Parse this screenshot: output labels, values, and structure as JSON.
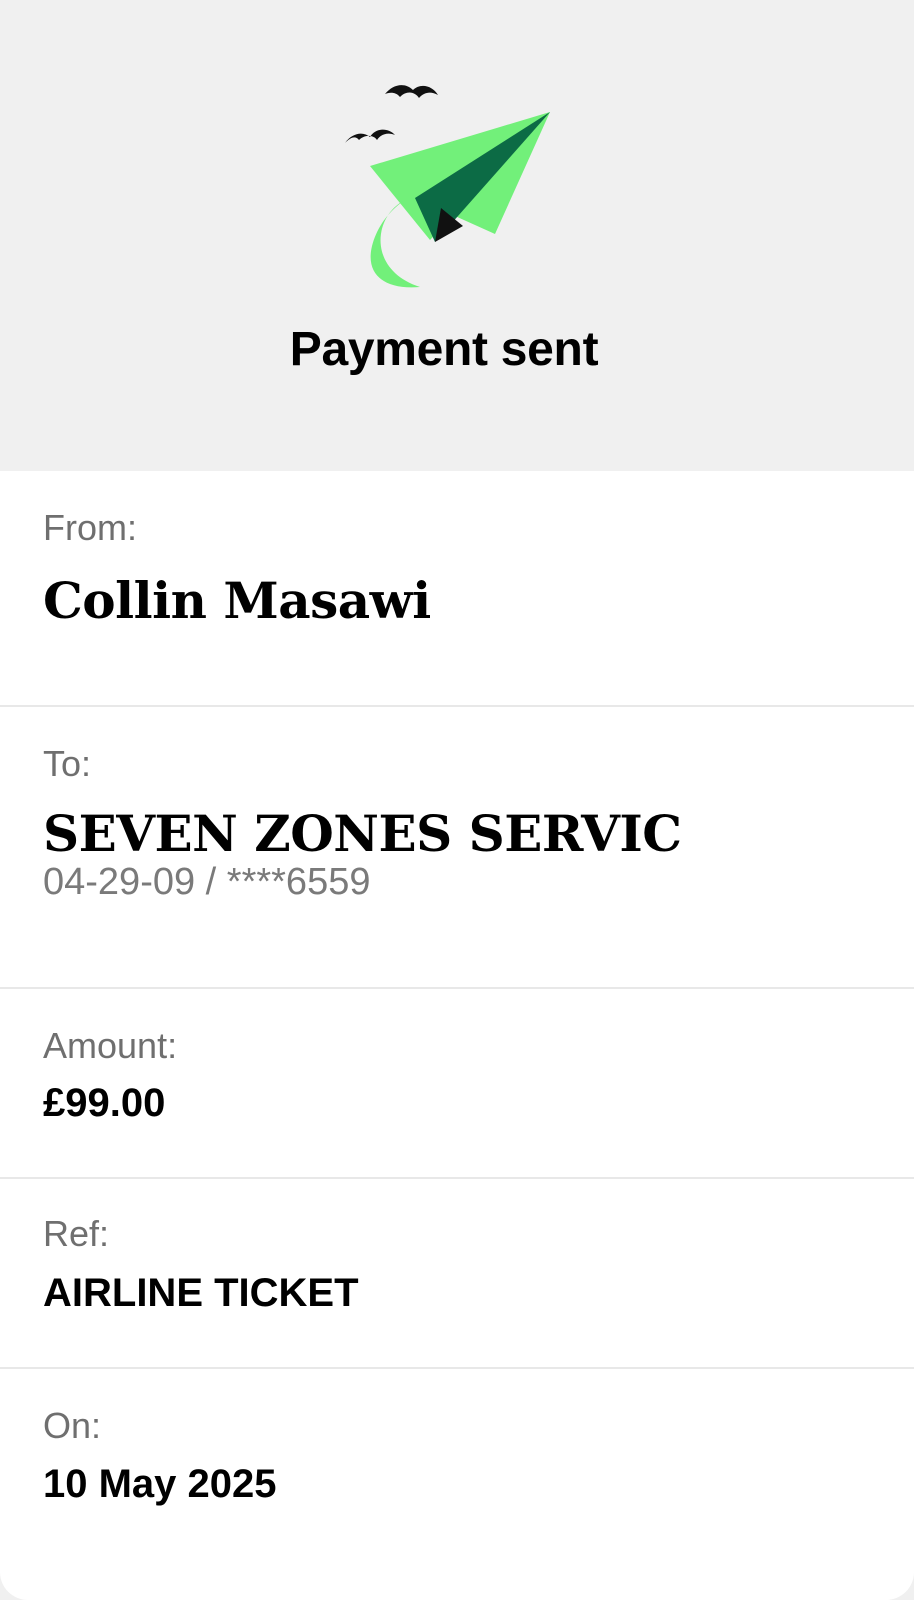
{
  "header": {
    "title": "Payment sent",
    "illustration_icon": "paper-plane-with-birds-icon",
    "colors": {
      "plane_light": "#72f07a",
      "plane_dark": "#0c6b45",
      "plane_shadow": "#111111",
      "birds": "#111111"
    }
  },
  "details": {
    "from": {
      "label": "From:",
      "value": "Collin Masawi"
    },
    "to": {
      "label": "To:",
      "value": "SEVEN ZONES SERVIC",
      "account": "04-29-09 / ****6559"
    },
    "amount": {
      "label": "Amount:",
      "value": "£99.00"
    },
    "ref": {
      "label": "Ref:",
      "value": "AIRLINE TICKET"
    },
    "on": {
      "label": "On:",
      "value": "10 May 2025"
    }
  },
  "colors": {
    "header_background": "#f0f0f0",
    "card_background": "#ffffff",
    "label_text": "#6f6f6f",
    "value_text": "#000000",
    "divider": "#e8e8e8"
  }
}
